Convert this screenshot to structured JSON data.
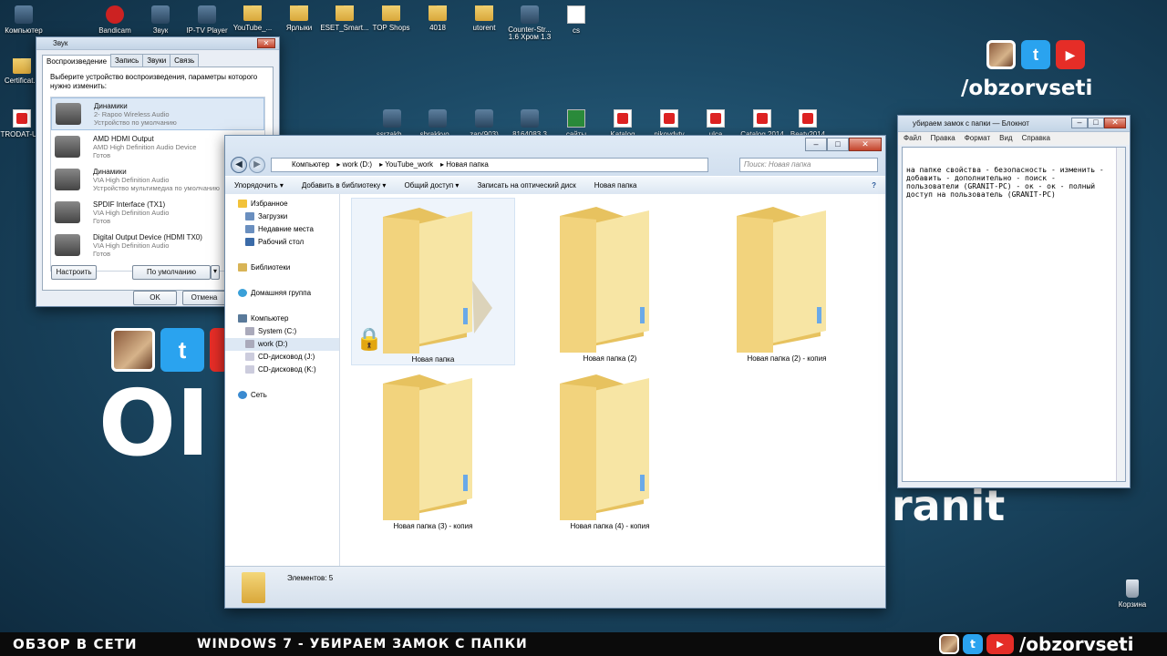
{
  "desktop": {
    "icons_row1": [
      "Компьютер",
      "Bandicam",
      "Звук",
      "IP-TV Player",
      "YouTube_...",
      "Ярлыки",
      "ESET_Smart...",
      "TOP Shops",
      "4018",
      "utorent",
      "Counter-Str... 1.6 Хром 1.3",
      "cs"
    ],
    "icons_left": [
      "Certificat...",
      "TRODAT-U..."
    ],
    "icons_row2": [
      "ssrzakb...",
      "sbrakkvo...",
      "zap(903)",
      "8164083 3",
      "сайты",
      "Katalog",
      "nikoydvty",
      "ulca",
      "Catalog 2014",
      "Beaty2014"
    ],
    "recycle": "Корзина"
  },
  "branding": {
    "handle": "/obzorvseti",
    "big_letters": "OI",
    "granit": "ranit"
  },
  "sound_dialog": {
    "title": "Звук",
    "tabs": [
      "Воспроизведение",
      "Запись",
      "Звуки",
      "Связь"
    ],
    "instruction": "Выберите устройство воспроизведения, параметры которого нужно изменить:",
    "devices": [
      {
        "name": "Динамики",
        "sub1": "2- Rapoo Wireless Audio",
        "sub2": "Устройство по умолчанию"
      },
      {
        "name": "AMD HDMI Output",
        "sub1": "AMD High Definition Audio Device",
        "sub2": "Готов"
      },
      {
        "name": "Динамики",
        "sub1": "VIA High Definition Audio",
        "sub2": "Устройство мультимедиа по умолчанию"
      },
      {
        "name": "SPDIF Interface (TX1)",
        "sub1": "VIA High Definition Audio",
        "sub2": "Готов"
      },
      {
        "name": "Digital Output Device (HDMI TX0)",
        "sub1": "VIA High Definition Audio",
        "sub2": "Готов"
      }
    ],
    "configure_label": "Настроить",
    "default_label": "По умолчанию",
    "ok_label": "OK",
    "cancel_label": "Отмена"
  },
  "explorer": {
    "address": [
      "Компьютер",
      "work (D:)",
      "YouTube_work",
      "Новая папка"
    ],
    "search_placeholder": "Поиск: Новая папка",
    "toolbar": [
      "Упорядочить ▾",
      "Добавить в библиотеку ▾",
      "Общий доступ ▾",
      "Записать на оптический диск",
      "Новая папка"
    ],
    "nav": {
      "favorites": "Избранное",
      "fav_items": [
        "Загрузки",
        "Недавние места",
        "Рабочий стол"
      ],
      "libraries": "Библиотеки",
      "homegroup": "Домашняя группа",
      "computer": "Компьютер",
      "drives": [
        "System (C:)",
        "work (D:)",
        "CD-дисковод (J:)",
        "CD-дисковод (K:)"
      ],
      "network": "Сеть"
    },
    "folders": [
      "Новая папка",
      "Новая папка (2)",
      "Новая папка (2) - копия",
      "Новая папка (3) - копия",
      "Новая папка (4) - копия"
    ],
    "status": "Элементов: 5"
  },
  "notepad": {
    "title": "убираем замок с папки — Блокнот",
    "menu": [
      "Файл",
      "Правка",
      "Формат",
      "Вид",
      "Справка"
    ],
    "text": "на папке свойства - безопасность - изменить - добавить - дополнительно - поиск - пользователи (GRANIT-PC) - ок - ок - полный доступ на пользователь (GRANIT-PC)"
  },
  "bottom": {
    "left": "ОБЗОР В СЕТИ",
    "center": "WINDOWS 7 - УБИРАЕМ ЗАМОК С ПАПКИ",
    "right": "/obzorvseti"
  }
}
